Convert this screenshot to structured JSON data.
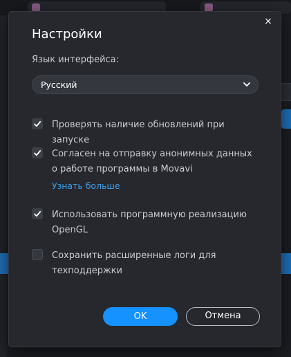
{
  "dialog": {
    "title": "Настройки",
    "close_glyph": "×",
    "language_label": "Язык интерфейса:",
    "language_value": "Русский",
    "options": [
      {
        "label": "Проверять наличие обновлений при запуске",
        "checked": true
      },
      {
        "label": "Согласен на отправку анонимных данных о работе программы в Movavi",
        "checked": true
      },
      {
        "label": "Использовать программную реализацию OpenGL",
        "checked": true
      },
      {
        "label": "Сохранить расширенные логи для техподдержки",
        "checked": false
      }
    ],
    "learn_more": "Узнать больше",
    "ok_label": "OK",
    "cancel_label": "Отмена"
  },
  "colors": {
    "accent": "#1592ff",
    "link": "#3d9fea",
    "dialog_bg": "#26282e"
  },
  "icons": {
    "close": "close-icon",
    "dropdown": "chevron-down-icon",
    "check": "check-icon"
  }
}
